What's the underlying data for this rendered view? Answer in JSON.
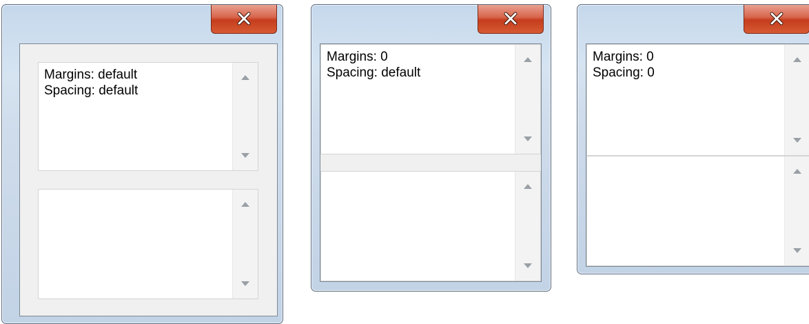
{
  "windows": [
    {
      "id": "w1",
      "text_lines": [
        "Margins: default",
        "Spacing: default"
      ]
    },
    {
      "id": "w2",
      "text_lines": [
        "Margins: 0",
        "Spacing: default"
      ]
    },
    {
      "id": "w3",
      "text_lines": [
        "Margins: 0",
        "Spacing: 0"
      ]
    }
  ],
  "icons": {
    "close": "close-icon",
    "scroll_up": "scroll-up-arrow-icon",
    "scroll_down": "scroll-down-arrow-icon"
  },
  "colors": {
    "close_button": "#c53d1d",
    "frame": "#c9d9ea",
    "client": "#f0f0f0"
  }
}
